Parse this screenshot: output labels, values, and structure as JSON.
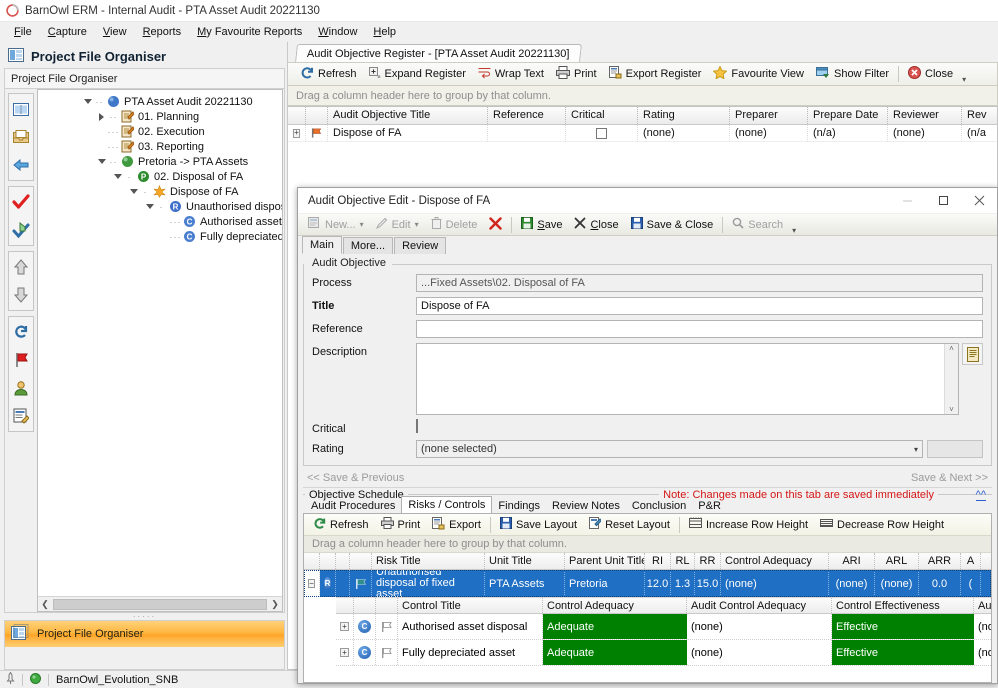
{
  "window": {
    "title": "BarnOwl ERM - Internal Audit - PTA Asset Audit 20221130",
    "logo_icon": "barnowl-logo-icon"
  },
  "menu": {
    "items": [
      {
        "label": "File",
        "accel": "F"
      },
      {
        "label": "Capture",
        "accel": "C"
      },
      {
        "label": "View",
        "accel": "V"
      },
      {
        "label": "Reports",
        "accel": "R"
      },
      {
        "label": "My Favourite Reports",
        "accel": "M"
      },
      {
        "label": "Window",
        "accel": "W"
      },
      {
        "label": "Help",
        "accel": "H"
      }
    ]
  },
  "left_panel": {
    "header": "Project File Organiser",
    "subheader": "Project File Organiser",
    "footer_item": "Project File Organiser",
    "toolbar_icons": [
      {
        "name": "book-open-icon"
      },
      {
        "name": "inbox-tray-icon"
      },
      {
        "name": "back-arrow-icon"
      },
      {
        "name": "red-check-icon"
      },
      {
        "name": "blue-check-home-icon"
      },
      {
        "name": "move-up-icon"
      },
      {
        "name": "move-down-icon"
      },
      {
        "name": "refresh-cycle-icon"
      },
      {
        "name": "red-flag-icon"
      },
      {
        "name": "user-icon"
      },
      {
        "name": "report-edit-icon"
      }
    ],
    "tree": [
      {
        "label": "PTA Asset Audit 20221130",
        "depth": 0,
        "expander": "down",
        "icon": "blue-sphere-icon"
      },
      {
        "label": "01. Planning",
        "depth": 1,
        "expander": "right",
        "icon": "orange-folder-doc-icon"
      },
      {
        "label": "02. Execution",
        "depth": 1,
        "expander": "none",
        "icon": "orange-folder-doc-icon"
      },
      {
        "label": "03. Reporting",
        "depth": 1,
        "expander": "none",
        "icon": "orange-folder-doc-icon"
      },
      {
        "label": "Pretoria -> PTA Assets",
        "depth": 1,
        "expander": "down",
        "icon": "green-sphere-icon"
      },
      {
        "label": "02. Disposal of FA",
        "depth": 2,
        "expander": "down",
        "icon": "green-p-badge-icon"
      },
      {
        "label": "Dispose of FA",
        "depth": 3,
        "expander": "down",
        "icon": "orange-star-icon"
      },
      {
        "label": "Unauthorised disposal of fixed asse",
        "depth": 4,
        "expander": "down",
        "icon": "blue-r-badge-icon"
      },
      {
        "label": "Authorised asset disposal",
        "depth": 5,
        "expander": "none",
        "icon": "blue-c-badge-icon"
      },
      {
        "label": "Fully depreciated asset",
        "depth": 5,
        "expander": "none",
        "icon": "blue-c-badge-icon"
      }
    ]
  },
  "document_tab": {
    "label": "Audit Objective Register - [PTA Asset Audit 20221130]"
  },
  "register_toolbar": {
    "items": [
      {
        "label": "Refresh",
        "icon": "refresh-icon"
      },
      {
        "label": "Expand Register",
        "icon": "expand-icon"
      },
      {
        "label": "Wrap Text",
        "icon": "wrap-text-icon"
      },
      {
        "label": "Print",
        "icon": "printer-icon"
      },
      {
        "label": "Export Register",
        "icon": "export-icon"
      },
      {
        "label": "Favourite View",
        "icon": "star-icon"
      },
      {
        "label": "Show Filter",
        "icon": "filter-icon"
      },
      {
        "label": "Close",
        "icon": "close-circle-icon"
      }
    ],
    "overflow_icon": "toolbar-overflow-icon"
  },
  "register_grid": {
    "group_hint": "Drag a column header here to group by that column.",
    "columns": [
      "Audit Objective Title",
      "Reference",
      "Critical",
      "Rating",
      "Preparer",
      "Prepare Date",
      "Reviewer",
      "Rev"
    ],
    "rows": [
      {
        "expander_icon": "row-expand-icon",
        "flag_icon": "orange-flag-icon",
        "Audit Objective Title": "Dispose of FA",
        "Reference": "",
        "Critical": "",
        "Rating": "(none)",
        "Preparer": "(none)",
        "Prepare Date": "(n/a)",
        "Reviewer": "(none)",
        "Rev": "(n/a"
      }
    ]
  },
  "dialog": {
    "title": "Audit Objective Edit - Dispose of FA",
    "window_buttons": [
      {
        "name": "minimize-button",
        "glyph": "—",
        "disabled": true
      },
      {
        "name": "maximize-button",
        "glyph": "❐",
        "disabled": false
      },
      {
        "name": "close-button",
        "glyph": "✕",
        "disabled": false
      }
    ],
    "toolbar": [
      {
        "label": "New...",
        "icon": "new-record-icon",
        "disabled": true,
        "dropdown": true
      },
      {
        "label": "Edit",
        "icon": "pencil-icon",
        "disabled": true,
        "dropdown": true
      },
      {
        "label": "Delete",
        "icon": "trash-icon",
        "disabled": true
      },
      {
        "label": "",
        "icon": "red-x-icon",
        "disabled": false
      },
      {
        "label": "Save",
        "icon": "save-green-icon",
        "disabled": false,
        "accel": "S"
      },
      {
        "label": "Close",
        "icon": "x-icon",
        "disabled": false,
        "accel": "C"
      },
      {
        "label": "Save & Close",
        "icon": "save-blue-icon",
        "disabled": false
      },
      {
        "label": "Search",
        "icon": "search-icon",
        "disabled": true
      }
    ],
    "tabs": [
      {
        "label": "Main",
        "active": true
      },
      {
        "label": "More...",
        "active": false
      },
      {
        "label": "Review",
        "active": false
      }
    ],
    "fieldset_legend": "Audit Objective",
    "fields": {
      "process": {
        "label": "Process",
        "value": "...Fixed Assets\\02. Disposal of FA",
        "readonly": true
      },
      "title": {
        "label": "Title",
        "value": "Dispose of FA",
        "readonly": false
      },
      "reference": {
        "label": "Reference",
        "value": "",
        "readonly": false
      },
      "description": {
        "label": "Description",
        "value": "",
        "readonly": false,
        "memo_icon": "memo-editor-icon"
      },
      "critical": {
        "label": "Critical",
        "checked": false
      },
      "rating": {
        "label": "Rating",
        "value": "(none selected)"
      }
    },
    "nav": {
      "prev": "<< Save & Previous",
      "next": "Save & Next >>"
    },
    "schedule": {
      "legend": "Objective Schedule",
      "note": "Note: Changes made on this tab are saved immediately",
      "collapse_glyph": "^^",
      "tabs": [
        {
          "label": "Audit Procedures",
          "active": false
        },
        {
          "label": "Risks / Controls",
          "active": true
        },
        {
          "label": "Findings",
          "active": false
        },
        {
          "label": "Review Notes",
          "active": false
        },
        {
          "label": "Conclusion",
          "active": false
        },
        {
          "label": "P&R",
          "active": false
        }
      ],
      "toolbar": [
        {
          "label": "Refresh",
          "icon": "refresh-icon"
        },
        {
          "label": "Print",
          "icon": "printer-icon"
        },
        {
          "label": "Export",
          "icon": "export-icon"
        },
        {
          "label": "Save Layout",
          "icon": "save-blue-icon"
        },
        {
          "label": "Reset Layout",
          "icon": "reset-layout-icon"
        },
        {
          "label": "Increase Row Height",
          "icon": "increase-row-height-icon"
        },
        {
          "label": "Decrease Row Height",
          "icon": "decrease-row-height-icon"
        }
      ],
      "group_hint": "Drag a column header here to group by that column.",
      "risk_columns": [
        "Risk Title",
        "Unit Title",
        "Parent Unit Title",
        "RI",
        "RL",
        "RR",
        "Control Adequacy",
        "ARI",
        "ARL",
        "ARR",
        "A"
      ],
      "risk_rows": [
        {
          "badge": "R",
          "flag_icon": "teal-flag-icon",
          "Risk Title": "Unauthorised disposal of fixed asset",
          "Unit Title": "PTA Assets",
          "Parent Unit Title": "Pretoria",
          "RI": "12.0",
          "RL": "1.3",
          "RR": "15.0",
          "Control Adequacy": "(none)",
          "ARI": "(none)",
          "ARL": "(none)",
          "ARR": "0.0",
          "A": "(",
          "selected": true
        }
      ],
      "control_columns": [
        "Control Title",
        "Control Adequacy",
        "Audit Control Adequacy",
        "Control Effectiveness",
        "Audi"
      ],
      "control_rows": [
        {
          "badge": "C",
          "flag_icon": "grey-flag-icon",
          "Control Title": "Authorised asset disposal",
          "Control Adequacy": "Adequate",
          "Audit Control Adequacy": "(none)",
          "Control Effectiveness": "Effective",
          "Audi": "(non"
        },
        {
          "badge": "C",
          "flag_icon": "grey-flag-icon",
          "Control Title": "Fully depreciated asset",
          "Control Adequacy": "Adequate",
          "Audit Control Adequacy": "(none)",
          "Control Effectiveness": "Effective",
          "Audi": "(non"
        }
      ]
    }
  },
  "statusbar": {
    "connection_icon": "green-status-icon",
    "left_icon": "pin-icon",
    "database": "BarnOwl_Evolution_SNB"
  },
  "colors": {
    "selection_blue": "#1f6fc4",
    "adequate_green": "#008000",
    "note_red": "#d41616",
    "highlight_orange": "#ffb43c"
  }
}
